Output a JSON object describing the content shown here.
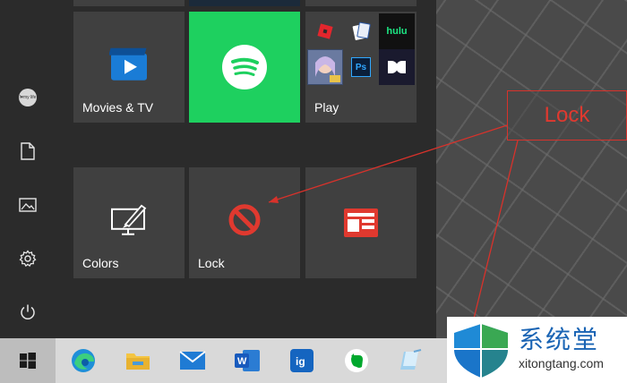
{
  "start_menu": {
    "user": {
      "avatar_text": "I♥my life"
    },
    "tiles": {
      "movies": {
        "label": "Movies & TV"
      },
      "spotify": {
        "label": ""
      },
      "play": {
        "label": "Play",
        "mini_tiles": [
          "hulu",
          "Ps"
        ]
      },
      "colors": {
        "label": "Colors"
      },
      "lock": {
        "label": "Lock"
      },
      "news": {
        "label": ""
      }
    }
  },
  "annotation": {
    "callout_text": "Lock",
    "color": "#d8322b"
  },
  "watermark": {
    "title": "系统堂",
    "url": "xitongtang.com"
  },
  "taskbar": {
    "apps": [
      "start-icon",
      "edge-icon",
      "file-explorer-icon",
      "mail-icon",
      "word-icon",
      "igdm-icon",
      "evernote-icon",
      "notepad-icon"
    ]
  },
  "colors": {
    "spotify_green": "#1ed05f",
    "tile_bg": "#404040",
    "menu_bg": "#2b2b2b",
    "accent_red": "#d8322b"
  }
}
